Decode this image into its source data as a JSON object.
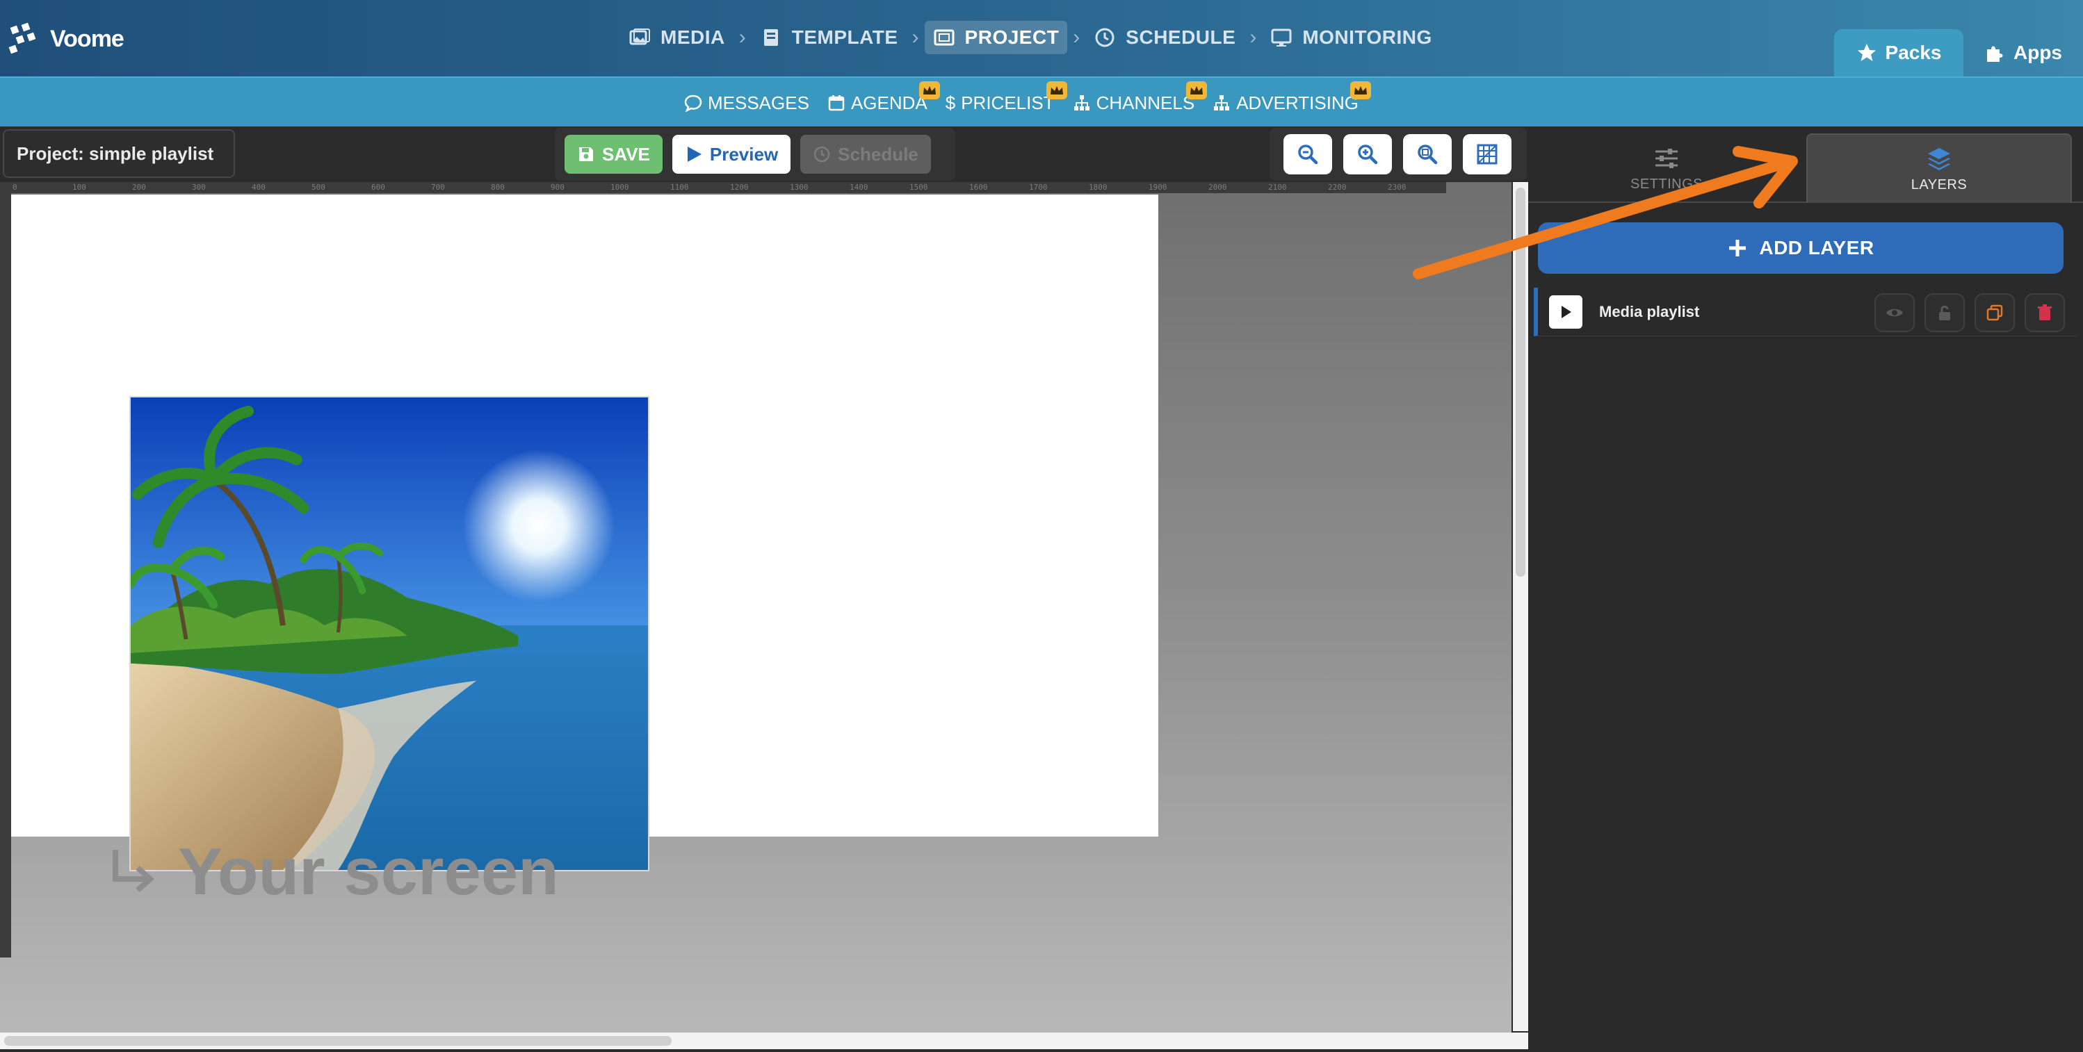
{
  "app": {
    "name": "Voome"
  },
  "nav": {
    "items": [
      {
        "label": "MEDIA",
        "icon": "media-icon"
      },
      {
        "label": "TEMPLATE",
        "icon": "template-icon"
      },
      {
        "label": "PROJECT",
        "icon": "project-icon",
        "active": true
      },
      {
        "label": "SCHEDULE",
        "icon": "clock-icon"
      },
      {
        "label": "MONITORING",
        "icon": "monitor-icon"
      }
    ],
    "right_tabs": [
      {
        "label": "Packs",
        "icon": "star-icon",
        "active": true
      },
      {
        "label": "Apps",
        "icon": "puzzle-icon"
      }
    ]
  },
  "subnav": {
    "items": [
      {
        "label": "MESSAGES",
        "icon": "chat-icon",
        "premium": false
      },
      {
        "label": "AGENDA",
        "icon": "calendar-icon",
        "premium": true
      },
      {
        "label": "PRICELIST",
        "icon": "dollar-icon",
        "premium": true
      },
      {
        "label": "CHANNELS",
        "icon": "sitemap-icon",
        "premium": true
      },
      {
        "label": "ADVERTISING",
        "icon": "sitemap-icon",
        "premium": true
      }
    ]
  },
  "editor": {
    "project_label": "Project: simple playlist",
    "save_label": "SAVE",
    "preview_label": "Preview",
    "schedule_label": "Schedule",
    "zoom_buttons": [
      "zoom-out-icon",
      "zoom-in-icon",
      "zoom-fit-icon",
      "grid-icon"
    ]
  },
  "canvas": {
    "ruler_ticks": [
      "0",
      "100",
      "200",
      "300",
      "400",
      "500",
      "600",
      "700",
      "800",
      "900",
      "1000",
      "1100",
      "1200",
      "1300",
      "1400",
      "1500",
      "1600",
      "1700",
      "1800",
      "1900",
      "2000",
      "2100",
      "2200",
      "2300"
    ],
    "watermark": "Your screen"
  },
  "panel": {
    "tabs": [
      {
        "label": "SETTINGS",
        "icon": "sliders-icon"
      },
      {
        "label": "LAYERS",
        "icon": "layers-icon",
        "active": true
      }
    ],
    "add_layer_label": "ADD LAYER",
    "layers": [
      {
        "name": "Media playlist",
        "icon": "play-icon"
      }
    ]
  },
  "colors": {
    "accent": "#2e6cba",
    "subbar": "#3a97bf",
    "save": "#6fbf73",
    "annotation": "#f07a1e",
    "premium": "#f1b739"
  }
}
